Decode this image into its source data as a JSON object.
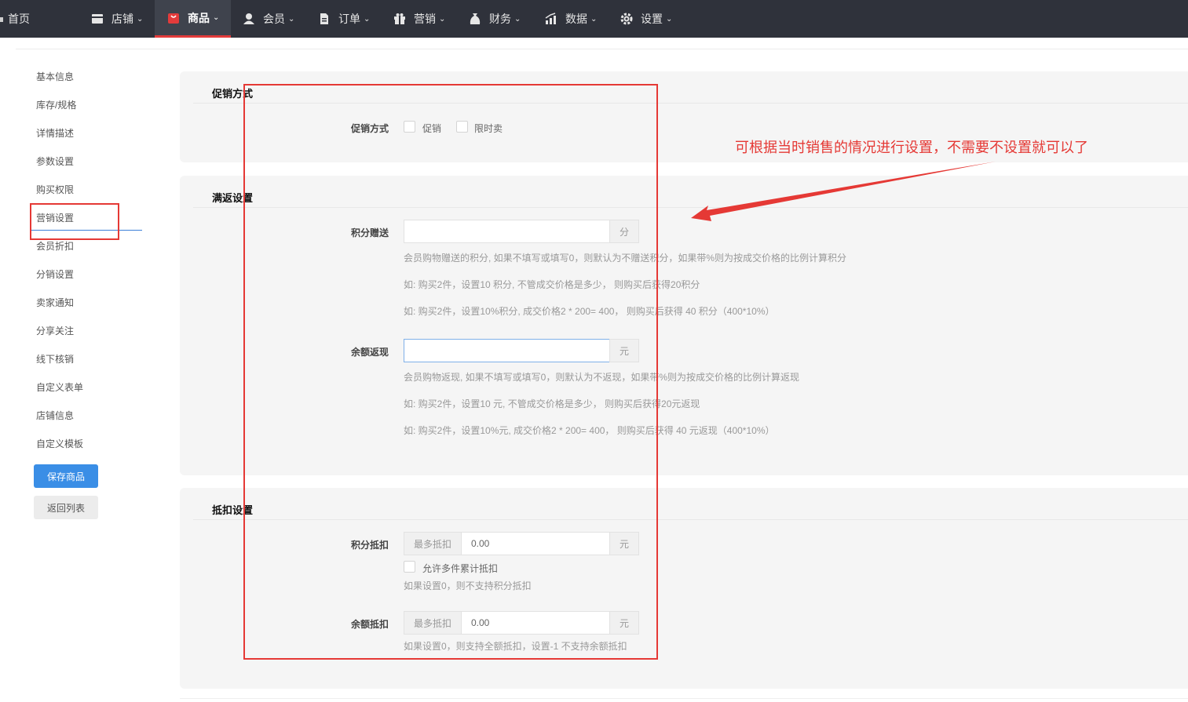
{
  "topnav": {
    "items": [
      {
        "label": "首页",
        "icon": "home-icon"
      },
      {
        "label": "店铺",
        "icon": "store-icon"
      },
      {
        "label": "商品",
        "icon": "goods-icon",
        "active": true
      },
      {
        "label": "会员",
        "icon": "user-icon"
      },
      {
        "label": "订单",
        "icon": "order-icon"
      },
      {
        "label": "营销",
        "icon": "gift-icon"
      },
      {
        "label": "财务",
        "icon": "money-bag-icon"
      },
      {
        "label": "数据",
        "icon": "chart-icon"
      },
      {
        "label": "设置",
        "icon": "gear-icon"
      }
    ],
    "active_color": "#e33b3b"
  },
  "sidebar": {
    "items": [
      {
        "label": "基本信息"
      },
      {
        "label": "库存/规格"
      },
      {
        "label": "详情描述"
      },
      {
        "label": "参数设置"
      },
      {
        "label": "购买权限"
      },
      {
        "label": "营销设置",
        "highlighted": true
      },
      {
        "label": "会员折扣"
      },
      {
        "label": "分销设置"
      },
      {
        "label": "卖家通知"
      },
      {
        "label": "分享关注"
      },
      {
        "label": "线下核销"
      },
      {
        "label": "自定义表单"
      },
      {
        "label": "店铺信息"
      },
      {
        "label": "自定义模板"
      }
    ],
    "save_label": "保存商品",
    "back_label": "返回列表"
  },
  "promo": {
    "title": "促销方式",
    "field_label": "促销方式",
    "option1": "促销",
    "option2": "限时卖"
  },
  "rebate": {
    "title": "满返设置",
    "points_label": "积分赠送",
    "points_value": "",
    "points_unit": "分",
    "points_hint1": "会员购物赠送的积分, 如果不填写或填写0，则默认为不赠送积分，如果带%则为按成交价格的比例计算积分",
    "points_hint2": "如: 购买2件，设置10 积分, 不管成交价格是多少， 则购买后获得20积分",
    "points_hint3": "如: 购买2件，设置10%积分, 成交价格2 * 200= 400， 则购买后获得 40 积分（400*10%）",
    "balance_label": "余额返现",
    "balance_value": "",
    "balance_unit": "元",
    "balance_hint1": "会员购物返现, 如果不填写或填写0，则默认为不返现，如果带%则为按成交价格的比例计算返现",
    "balance_hint2": "如: 购买2件，设置10 元, 不管成交价格是多少， 则购买后获得20元返现",
    "balance_hint3": "如: 购买2件，设置10%元, 成交价格2 * 200= 400， 则购买后获得 40 元返现（400*10%）"
  },
  "deduct": {
    "title": "抵扣设置",
    "points_label": "积分抵扣",
    "points_prefix": "最多抵扣",
    "points_value": "0.00",
    "points_unit": "元",
    "multi_label": "允许多件累计抵扣",
    "points_hint": "如果设置0，则不支持积分抵扣",
    "balance_label": "余额抵扣",
    "balance_prefix": "最多抵扣",
    "balance_value": "0.00",
    "balance_unit": "元",
    "balance_hint": "如果设置0，则支持全额抵扣，设置-1 不支持余额抵扣"
  },
  "annotation": {
    "text": "可根据当时销售的情况进行设置，不需要不设置就可以了",
    "color": "#e53935"
  }
}
